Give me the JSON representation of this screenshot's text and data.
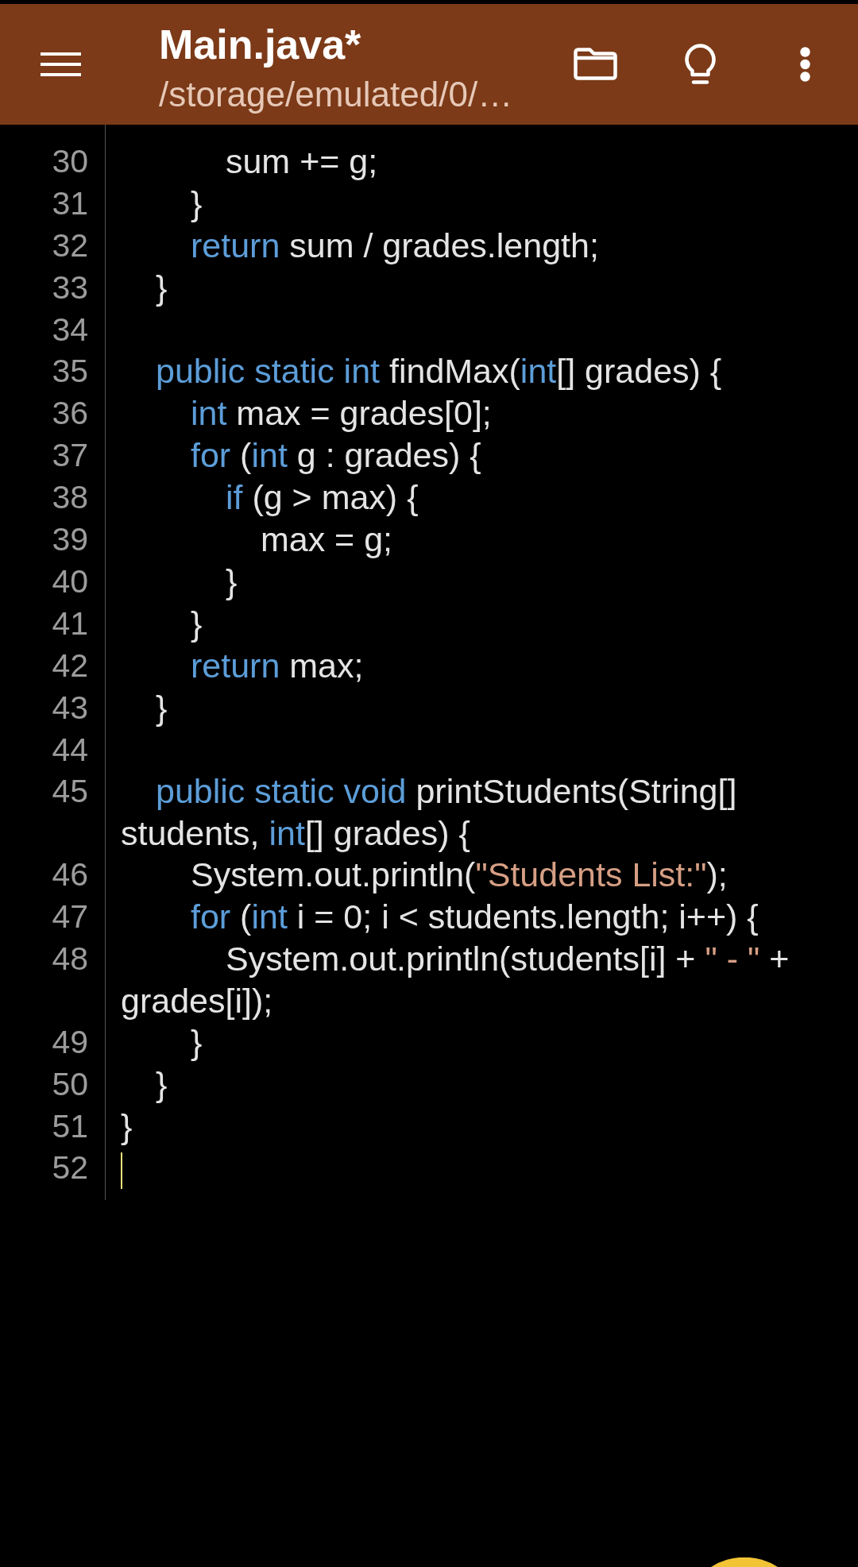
{
  "app_bar": {
    "title": "Main.java*",
    "subtitle": "/storage/emulated/0/…"
  },
  "editor": {
    "lines": [
      {
        "number": "30",
        "cursor": false,
        "code": [
          {
            "kind": "plain",
            "text": "            sum += g;"
          }
        ]
      },
      {
        "number": "31",
        "cursor": false,
        "code": [
          {
            "kind": "plain",
            "text": "        }"
          }
        ]
      },
      {
        "number": "32",
        "cursor": false,
        "code": [
          {
            "kind": "keyword",
            "text": "        return"
          },
          {
            "kind": "plain",
            "text": " sum / grades.length;"
          }
        ]
      },
      {
        "number": "33",
        "cursor": false,
        "code": [
          {
            "kind": "plain",
            "text": "    }"
          }
        ]
      },
      {
        "number": "34",
        "cursor": false
      },
      {
        "number": "35",
        "cursor": false,
        "code": [
          {
            "kind": "keyword",
            "text": "    public static int"
          },
          {
            "kind": "plain",
            "text": " findMax("
          },
          {
            "kind": "keyword",
            "text": "int"
          },
          {
            "kind": "plain",
            "text": "[] grades) {"
          }
        ]
      },
      {
        "number": "36",
        "cursor": false,
        "code": [
          {
            "kind": "keyword",
            "text": "        int"
          },
          {
            "kind": "plain",
            "text": " max = grades[0];"
          }
        ]
      },
      {
        "number": "37",
        "cursor": false,
        "code": [
          {
            "kind": "keyword",
            "text": "        for"
          },
          {
            "kind": "plain",
            "text": " ("
          },
          {
            "kind": "keyword",
            "text": "int"
          },
          {
            "kind": "plain",
            "text": " g : grades) {"
          }
        ]
      },
      {
        "number": "38",
        "cursor": false,
        "code": [
          {
            "kind": "keyword",
            "text": "            if"
          },
          {
            "kind": "plain",
            "text": " (g > max) {"
          }
        ]
      },
      {
        "number": "39",
        "cursor": false,
        "code": [
          {
            "kind": "plain",
            "text": "                max = g;"
          }
        ]
      },
      {
        "number": "40",
        "cursor": false,
        "code": [
          {
            "kind": "plain",
            "text": "            }"
          }
        ]
      },
      {
        "number": "41",
        "cursor": false,
        "code": [
          {
            "kind": "plain",
            "text": "        }"
          }
        ]
      },
      {
        "number": "42",
        "cursor": false,
        "code": [
          {
            "kind": "keyword",
            "text": "        return"
          },
          {
            "kind": "plain",
            "text": " max;"
          }
        ]
      },
      {
        "number": "43",
        "cursor": false,
        "code": [
          {
            "kind": "plain",
            "text": "    }"
          }
        ]
      },
      {
        "number": "44",
        "cursor": false
      },
      {
        "number": "45",
        "cursor": false,
        "code": [
          {
            "kind": "keyword",
            "text": "    public static void"
          },
          {
            "kind": "plain",
            "text": " printStudents(String[] students, "
          },
          {
            "kind": "keyword",
            "text": "int"
          },
          {
            "kind": "plain",
            "text": "[] grades) {"
          }
        ]
      },
      {
        "number": "46",
        "cursor": false,
        "code": [
          {
            "kind": "plain",
            "text": "        System.out.println("
          },
          {
            "kind": "string",
            "text": "\"Students List:\""
          },
          {
            "kind": "plain",
            "text": ");"
          }
        ]
      },
      {
        "number": "47",
        "cursor": false,
        "code": [
          {
            "kind": "keyword",
            "text": "        for"
          },
          {
            "kind": "plain",
            "text": " ("
          },
          {
            "kind": "keyword",
            "text": "int"
          },
          {
            "kind": "plain",
            "text": " i = 0; i < students.length; i++) {"
          }
        ]
      },
      {
        "number": "48",
        "cursor": false,
        "code": [
          {
            "kind": "plain",
            "text": "            System.out.println(students[i] + "
          },
          {
            "kind": "string",
            "text": "\" - \""
          },
          {
            "kind": "plain",
            "text": " + grades[i]);"
          }
        ]
      },
      {
        "number": "49",
        "cursor": false,
        "code": [
          {
            "kind": "plain",
            "text": "        }"
          }
        ]
      },
      {
        "number": "50",
        "cursor": false,
        "code": [
          {
            "kind": "plain",
            "text": "    }"
          }
        ]
      },
      {
        "number": "51",
        "cursor": false,
        "code": [
          {
            "kind": "plain",
            "text": "}"
          }
        ]
      },
      {
        "number": "52",
        "cursor": true
      }
    ]
  }
}
